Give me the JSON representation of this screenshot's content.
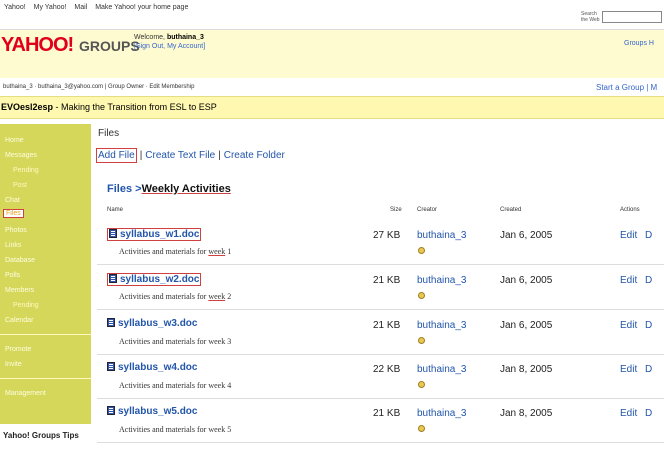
{
  "toplinks": {
    "yahoo": "Yahoo!",
    "my_yahoo": "My Yahoo!",
    "mail": "Mail",
    "make_home": "Make Yahoo! your home page"
  },
  "search": {
    "label": "Search the Web",
    "value": ""
  },
  "header": {
    "logo": "YAHOO!",
    "logo_groups": "GROUPS",
    "welcome_prefix": "Welcome, ",
    "username": "buthaina_3",
    "account_links": "[Sign Out, My Account]",
    "groups_home": "Groups H"
  },
  "userbar": {
    "info": "buthaina_3 · buthaina_3@yahoo.com | Group Owner · Edit Membership",
    "start_group": "Start a Group | M"
  },
  "group": {
    "name": "EVOesl2esp",
    "tagline": " - Making the Transition from ESL to ESP"
  },
  "sidebar": {
    "home": "Home",
    "messages": "Messages",
    "pending1": "Pending",
    "post": "Post",
    "chat": "Chat",
    "files": "Files",
    "photos": "Photos",
    "links": "Links",
    "database": "Database",
    "polls": "Polls",
    "members": "Members",
    "pending2": "Pending",
    "calendar": "Calendar",
    "promote": "Promote",
    "invite": "Invite",
    "management": "Management",
    "tips": "Yahoo! Groups Tips"
  },
  "main": {
    "title": "Files",
    "add_file": "Add File",
    "create_text": "Create Text File",
    "create_folder": "Create Folder",
    "sep": "|",
    "crumb_root": "Files",
    "crumb_sep": " >",
    "crumb_current": "Weekly Activities",
    "col_name": "Name",
    "col_size": "Size",
    "col_creator": "Creator",
    "col_created": "Created",
    "col_actions": "Actions",
    "desc_prefix": "Activities and materials for ",
    "week_word": "week",
    "edit": "Edit",
    "del": "D",
    "files": [
      {
        "name": "syllabus_w1.doc",
        "week": "1",
        "size": "27 KB",
        "creator": "buthaina_3",
        "created": "Jan 6, 2005"
      },
      {
        "name": "syllabus_w2.doc",
        "week": "2",
        "size": "21 KB",
        "creator": "buthaina_3",
        "created": "Jan 6, 2005"
      },
      {
        "name": "syllabus_w3.doc",
        "week": "3",
        "size": "21 KB",
        "creator": "buthaina_3",
        "created": "Jan 6, 2005"
      },
      {
        "name": "syllabus_w4.doc",
        "week": "4",
        "size": "22 KB",
        "creator": "buthaina_3",
        "created": "Jan 8, 2005"
      },
      {
        "name": "syllabus_w5.doc",
        "week": "5",
        "size": "21 KB",
        "creator": "buthaina_3",
        "created": "Jan 8, 2005"
      }
    ]
  },
  "colors": {
    "sidebar": "#d5d75a",
    "header": "#fffbd0",
    "link": "#2255aa",
    "logo": "#e0001b"
  }
}
